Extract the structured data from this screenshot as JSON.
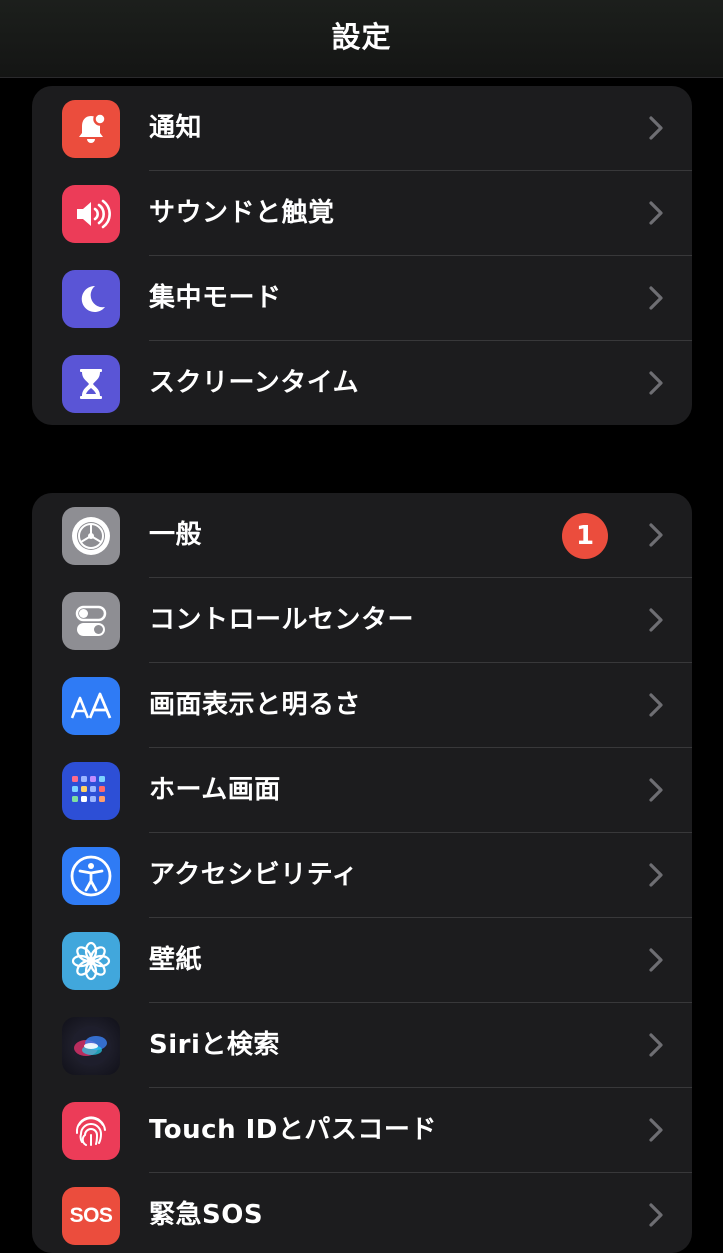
{
  "nav": {
    "title": "設定"
  },
  "group1": [
    {
      "id": "notifications",
      "label": "通知",
      "icon": "notification-bell-icon",
      "color": "#eb4d3d"
    },
    {
      "id": "sounds",
      "label": "サウンドと触覚",
      "icon": "speaker-icon",
      "color": "#ec3c58"
    },
    {
      "id": "focus",
      "label": "集中モード",
      "icon": "moon-icon",
      "color": "#5a55d6"
    },
    {
      "id": "screentime",
      "label": "スクリーンタイム",
      "icon": "hourglass-icon",
      "color": "#5a55d6"
    }
  ],
  "group2": [
    {
      "id": "general",
      "label": "一般",
      "icon": "gear-icon",
      "color": "#8e8e93",
      "badge": "1"
    },
    {
      "id": "control-center",
      "label": "コントロールセンター",
      "icon": "toggles-icon",
      "color": "#8e8e93"
    },
    {
      "id": "display",
      "label": "画面表示と明るさ",
      "icon": "text-size-icon",
      "color": "#2f7bf5"
    },
    {
      "id": "home-screen",
      "label": "ホーム画面",
      "icon": "app-grid-icon",
      "color": "#2d4fd6"
    },
    {
      "id": "accessibility",
      "label": "アクセシビリティ",
      "icon": "accessibility-icon",
      "color": "#2f7bf5"
    },
    {
      "id": "wallpaper",
      "label": "壁紙",
      "icon": "flower-icon",
      "color": "#41a7dc"
    },
    {
      "id": "siri",
      "label": "Siriと検索",
      "icon": "siri-icon",
      "color": "#1a1a2e"
    },
    {
      "id": "touch-id",
      "label": "Touch IDとパスコード",
      "icon": "fingerprint-icon",
      "color": "#ec3c58"
    },
    {
      "id": "sos",
      "label": "緊急SOS",
      "icon": "sos-icon",
      "color": "#eb4d3d",
      "icon_text": "SOS"
    }
  ]
}
